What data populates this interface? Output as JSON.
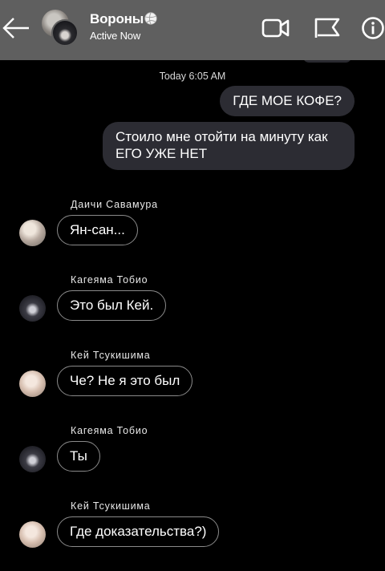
{
  "header": {
    "title": "Вороны",
    "status": "Active Now",
    "icons": {
      "back": "arrow-left-icon",
      "title_badge": "volleyball-icon",
      "video": "video-camera-icon",
      "flag": "flag-icon",
      "info": "info-icon"
    }
  },
  "colors": {
    "header_bg": "#5f5f5f",
    "background": "#000000",
    "outgoing_bubble": "#2c2c33",
    "incoming_border": "#8a8a8a"
  },
  "chat": {
    "timestamp": "Today 6:05 AM",
    "outgoing": [
      {
        "text": "ГДЕ МОЕ КОФЕ?"
      },
      {
        "text": "Стоило мне отойти на минуту как ЕГО УЖЕ НЕТ"
      }
    ],
    "incoming": [
      {
        "sender": "Даичи Савамура",
        "text": "Ян-сан..."
      },
      {
        "sender": "Кагеяма Тобио",
        "text": "Это был Кей."
      },
      {
        "sender": "Кей Тсукишима",
        "text": "Че? Не я это был"
      },
      {
        "sender": "Кагеяма Тобио",
        "text": "Ты"
      },
      {
        "sender": "Кей Тсукишима",
        "text": "Где доказательства?)"
      }
    ]
  }
}
